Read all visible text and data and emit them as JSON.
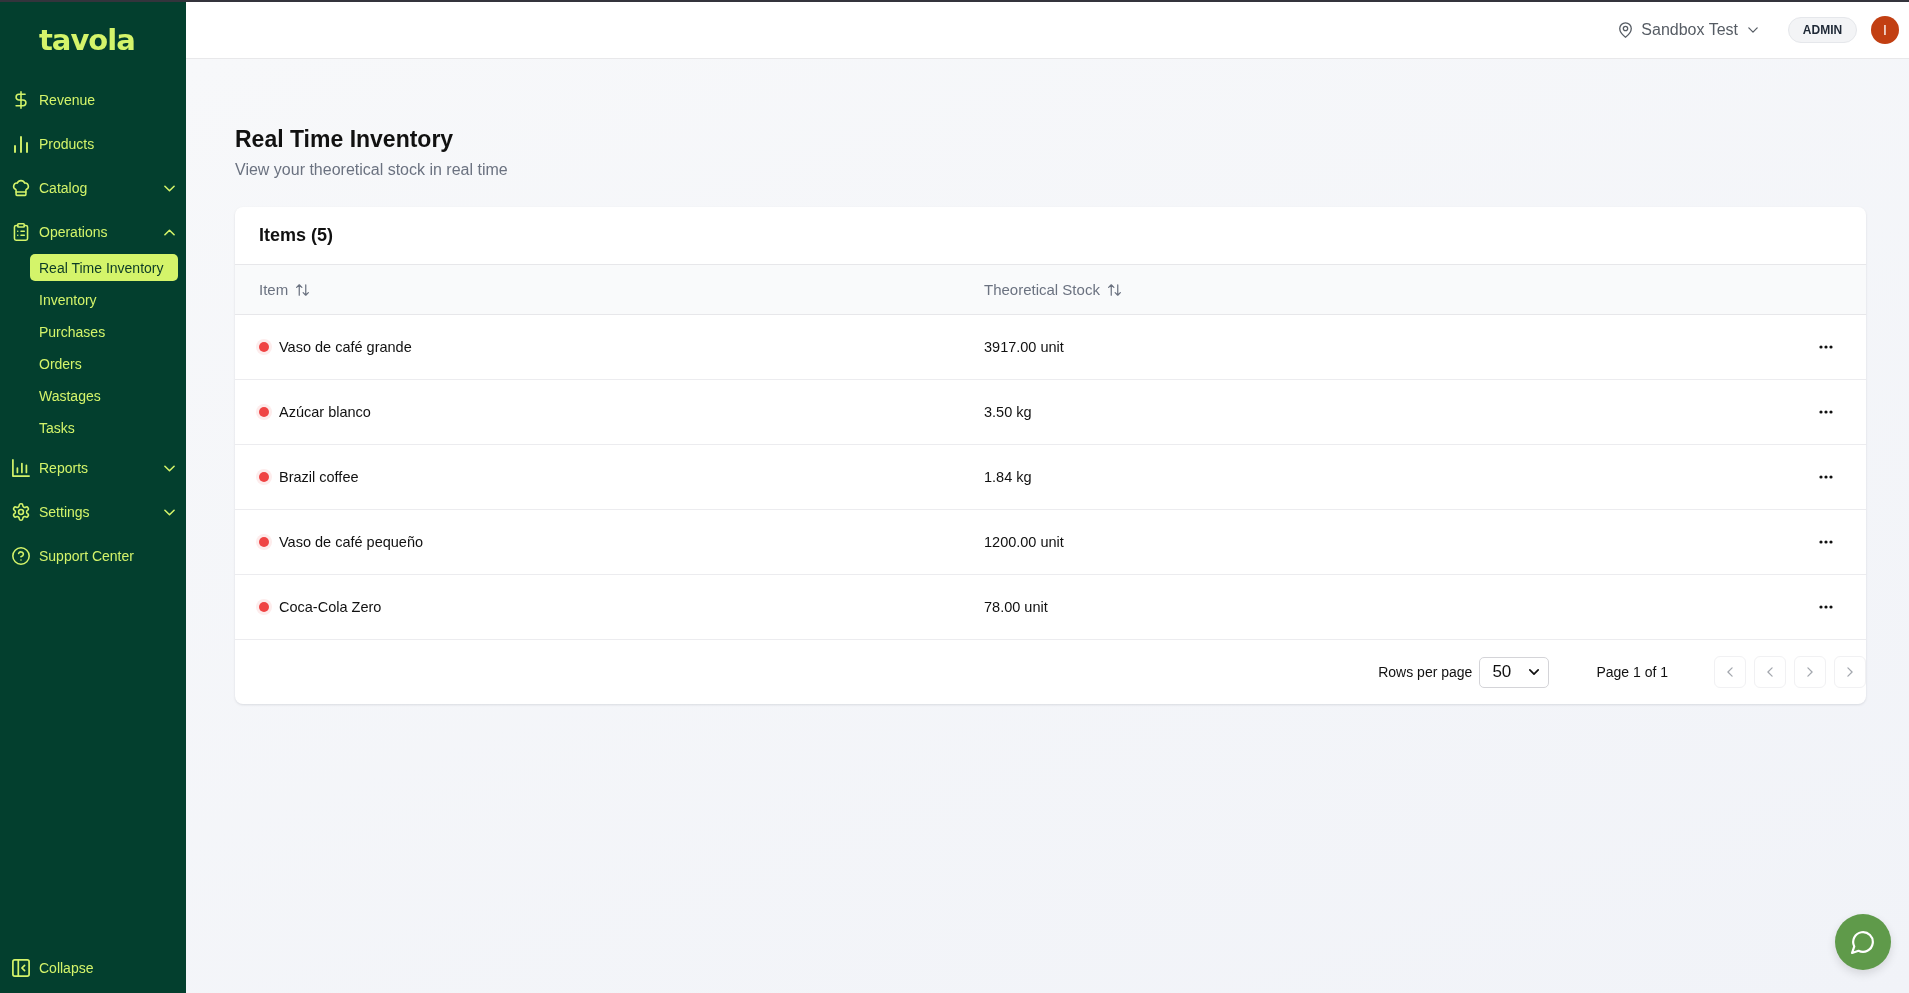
{
  "sidebar": {
    "logo": "tavola",
    "items": [
      {
        "kind": "link",
        "label": "Revenue",
        "selected": false
      },
      {
        "kind": "link",
        "label": "Products",
        "selected": false
      },
      {
        "kind": "group",
        "label": "Catalog",
        "expanded": false
      },
      {
        "kind": "group",
        "label": "Operations",
        "expanded": true,
        "children": [
          {
            "label": "Real Time Inventory",
            "selected": true
          },
          {
            "label": "Inventory",
            "selected": false
          },
          {
            "label": "Purchases",
            "selected": false
          },
          {
            "label": "Orders",
            "selected": false
          },
          {
            "label": "Wastages",
            "selected": false
          },
          {
            "label": "Tasks",
            "selected": false
          }
        ]
      },
      {
        "kind": "group",
        "label": "Reports",
        "expanded": false
      },
      {
        "kind": "group",
        "label": "Settings",
        "expanded": false
      },
      {
        "kind": "link",
        "label": "Support Center",
        "selected": false
      }
    ],
    "collapse": "Collapse"
  },
  "topbar": {
    "location": "Sandbox Test",
    "role": "ADMIN",
    "avatar": "I"
  },
  "page": {
    "title": "Real Time Inventory",
    "subtitle": "View your theoretical stock in real time"
  },
  "table": {
    "title": "Items (5)",
    "columns": [
      {
        "label": "Item"
      },
      {
        "label": "Theoretical Stock"
      }
    ],
    "rows": [
      {
        "item": "Vaso de café grande",
        "stock": "3917.00 unit",
        "color": "#ef4444"
      },
      {
        "item": "Azúcar blanco",
        "stock": "3.50 kg",
        "color": "#ef4444"
      },
      {
        "item": "Brazil coffee",
        "stock": "1.84 kg",
        "color": "#ef4444"
      },
      {
        "item": "Vaso de café pequeño",
        "stock": "1200.00 unit",
        "color": "#ef4444"
      },
      {
        "item": "Coca-Cola Zero",
        "stock": "78.00 unit",
        "color": "#ef4444"
      }
    ]
  },
  "pagination": {
    "rows_per_page_label": "Rows per page",
    "rows_per_page": "50",
    "page": "Page 1 of 1",
    "buttons": [
      {
        "kind": "first",
        "disabled": true
      },
      {
        "kind": "previous",
        "disabled": true
      },
      {
        "kind": "next",
        "disabled": true
      },
      {
        "kind": "last",
        "disabled": true
      }
    ]
  }
}
